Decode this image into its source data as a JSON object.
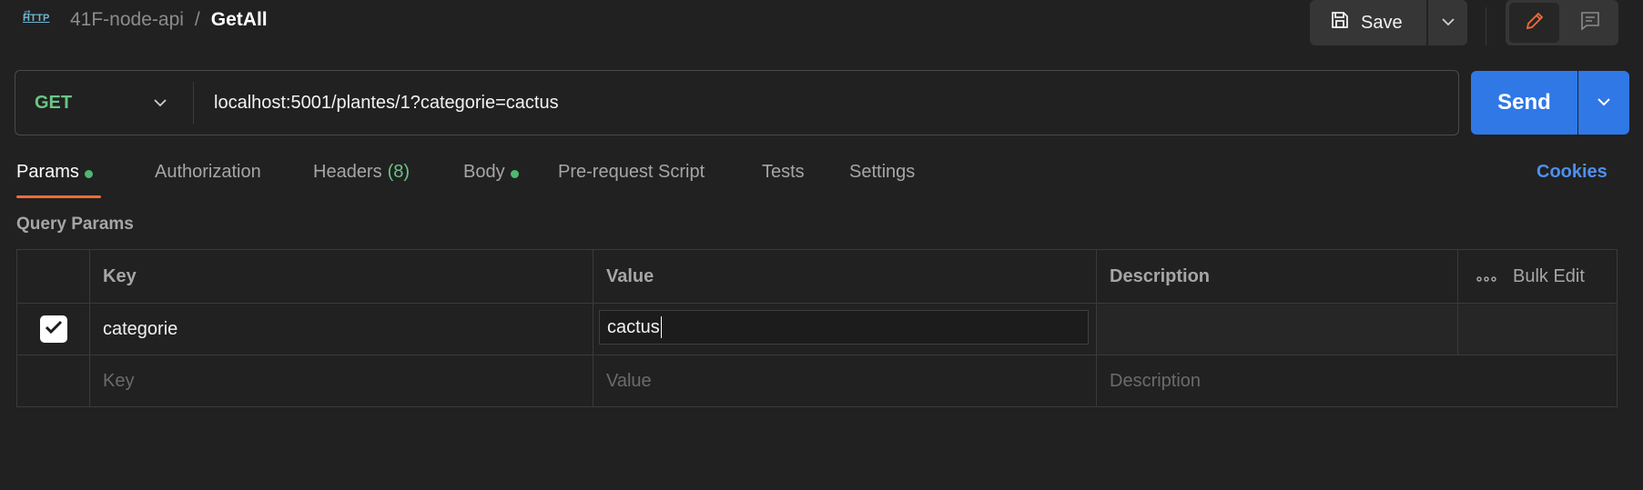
{
  "header": {
    "request_type_icon": "http-icon",
    "collection_name": "41F-node-api",
    "separator": "/",
    "request_name": "GetAll",
    "save_label": "Save"
  },
  "request": {
    "method": "GET",
    "method_color": "#6cc487",
    "url": "localhost:5001/plantes/1?categorie=cactus",
    "send_label": "Send",
    "send_color": "#2f78e6"
  },
  "tabs": [
    {
      "label": "Params",
      "active": true,
      "dot": true
    },
    {
      "label": "Authorization",
      "active": false
    },
    {
      "label": "Headers",
      "count": "(8)",
      "active": false
    },
    {
      "label": "Body",
      "active": false,
      "dot": true
    },
    {
      "label": "Pre-request Script",
      "active": false
    },
    {
      "label": "Tests",
      "active": false
    },
    {
      "label": "Settings",
      "active": false
    }
  ],
  "cookies_label": "Cookies",
  "query_params": {
    "title": "Query Params",
    "columns": {
      "key": "Key",
      "value": "Value",
      "description": "Description",
      "bulk_edit": "Bulk Edit"
    },
    "rows": [
      {
        "checked": true,
        "key": "categorie",
        "value": "cactus",
        "description": ""
      }
    ],
    "placeholders": {
      "key": "Key",
      "value": "Value",
      "description": "Description"
    }
  },
  "colors": {
    "background": "#212121",
    "active_tab_underline": "#f26b3a",
    "link_blue": "#4f8ff0",
    "status_dot_green": "#4fb870"
  }
}
